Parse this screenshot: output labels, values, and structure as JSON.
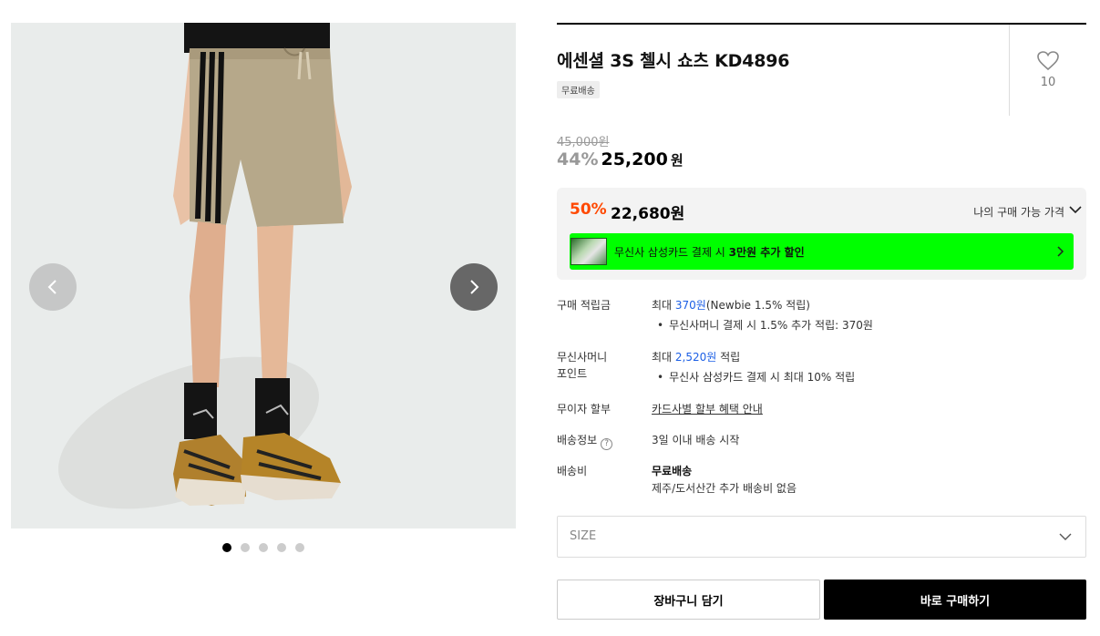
{
  "product": {
    "title": "에센셜 3S 첼시 쇼츠 KD4896",
    "badge": "무료배송",
    "like_count": "10",
    "original_price": "45,000원",
    "discount_rate": "44%",
    "discount_price": "25,200",
    "discount_price_unit": "원"
  },
  "my_price": {
    "rate": "50%",
    "price": "22,680원",
    "label": "나의 구매 가능 가격"
  },
  "card_banner": {
    "text_prefix": "무신사 삼성카드 결제 시 ",
    "text_bold": "3만원 추가 할인"
  },
  "info": {
    "points_label": "구매 적립금",
    "points_prefix": "최대 ",
    "points_value": "370원",
    "points_suffix": "(Newbie 1.5% 적립)",
    "points_sub": "무신사머니 결제 시 1.5% 추가 적립: 370원",
    "money_label_1": "무신사머니",
    "money_label_2": "포인트",
    "money_prefix": "최대 ",
    "money_value": "2,520원",
    "money_suffix": " 적립",
    "money_sub": "무신사 삼성카드 결제 시 최대 10% 적립",
    "installment_label": "무이자 할부",
    "installment_link": "카드사별 할부 혜택 안내",
    "shipping_label": "배송정보",
    "shipping_help": "?",
    "shipping_value": "3일 이내 배송 시작",
    "fee_label": "배송비",
    "fee_value": "무료배송",
    "fee_sub": "제주/도서산간 추가 배송비 없음"
  },
  "size_select": {
    "placeholder": "SIZE"
  },
  "buttons": {
    "cart": "장바구니 담기",
    "buy": "바로 구매하기"
  },
  "gallery": {
    "slide_count": 5,
    "active_index": 0
  },
  "colors": {
    "accent_discount": "#ff4800",
    "link_blue": "#1c5fe5",
    "card_banner_bg": "#00ff00"
  }
}
